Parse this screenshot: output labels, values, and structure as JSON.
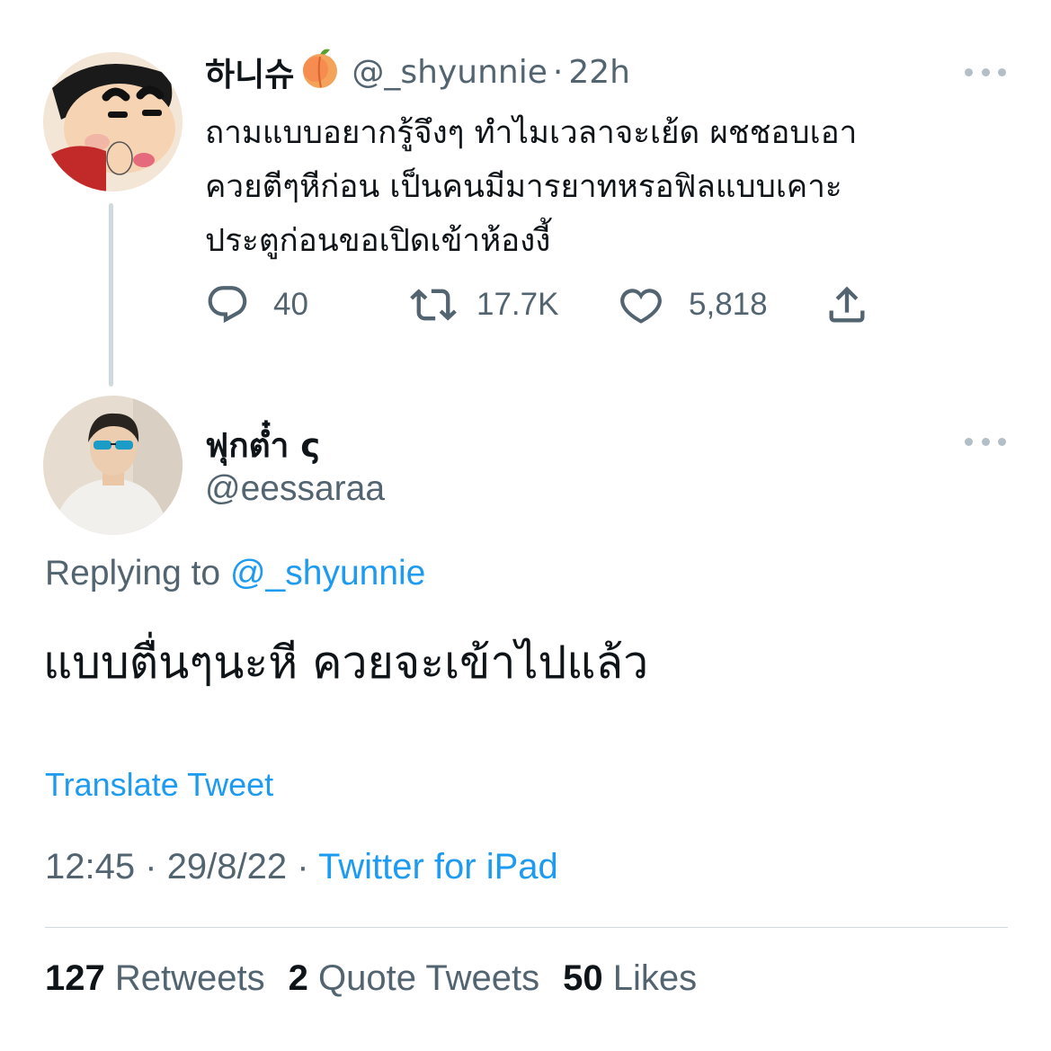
{
  "parent_tweet": {
    "display_name": "하니슈",
    "handle": "@_shyunnie",
    "separator": "·",
    "time": "22h",
    "text_lines": [
      "ถามแบบอยากรู้จึงๆ ทำไมเวลาจะเย้ด ผชชอบเอา",
      "ควยตีๆหีก่อน เป็นคนมีมารยาทหรอฟิลแบบเคาะ",
      "ประตูก่อนขอเปิดเข้าห้องงี้"
    ],
    "actions": {
      "replies": "40",
      "retweets": "17.7K",
      "likes": "5,818"
    }
  },
  "reply_tweet": {
    "display_name": "ฟุกต๋ำ ς",
    "handle": "@eessaraa",
    "replying_to_label": "Replying to",
    "replying_to_handle": "@_shyunnie",
    "text": "แบบตื่นๆนะหี ควยจะเข้าไปแล้ว",
    "translate_label": "Translate Tweet",
    "time": "12:45",
    "date": "29/8/22",
    "separator": "·",
    "client": "Twitter for iPad",
    "stats": {
      "retweets_count": "127",
      "retweets_label": "Retweets",
      "quotes_count": "2",
      "quotes_label": "Quote Tweets",
      "likes_count": "50",
      "likes_label": "Likes"
    }
  },
  "colors": {
    "link": "#1d9bf0",
    "secondary_text": "#536471",
    "primary_text": "#0f1419",
    "divider": "#cfd9de"
  }
}
